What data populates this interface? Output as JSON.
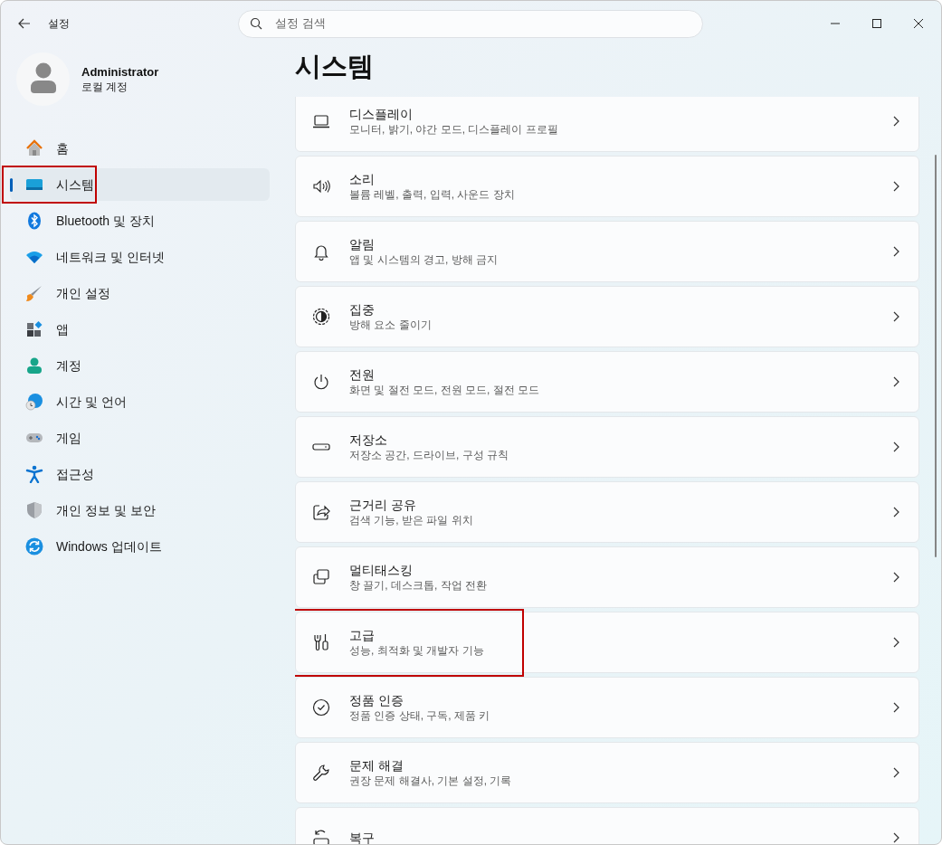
{
  "window": {
    "title": "설정",
    "search_placeholder": "설정 검색"
  },
  "account": {
    "name": "Administrator",
    "type": "로컬 계정"
  },
  "sidebar": {
    "items": [
      {
        "kind": "home",
        "label": "홈",
        "selected": false,
        "highlighted": false
      },
      {
        "kind": "system",
        "label": "시스템",
        "selected": true,
        "highlighted": true
      },
      {
        "kind": "bluetooth",
        "label": "Bluetooth 및 장치",
        "selected": false,
        "highlighted": false
      },
      {
        "kind": "network",
        "label": "네트워크 및 인터넷",
        "selected": false,
        "highlighted": false
      },
      {
        "kind": "brush",
        "label": "개인 설정",
        "selected": false,
        "highlighted": false
      },
      {
        "kind": "apps",
        "label": "앱",
        "selected": false,
        "highlighted": false
      },
      {
        "kind": "account",
        "label": "계정",
        "selected": false,
        "highlighted": false
      },
      {
        "kind": "time",
        "label": "시간 및 언어",
        "selected": false,
        "highlighted": false
      },
      {
        "kind": "game",
        "label": "게임",
        "selected": false,
        "highlighted": false
      },
      {
        "kind": "access",
        "label": "접근성",
        "selected": false,
        "highlighted": false
      },
      {
        "kind": "shield",
        "label": "개인 정보 및 보안",
        "selected": false,
        "highlighted": false
      },
      {
        "kind": "update",
        "label": "Windows 업데이트",
        "selected": false,
        "highlighted": false
      }
    ]
  },
  "page_title": "시스템",
  "cards": [
    {
      "kind": "display",
      "title": "디스플레이",
      "subtitle": "모니터, 밝기, 야간 모드, 디스플레이 프로필",
      "highlighted": false
    },
    {
      "kind": "sound",
      "title": "소리",
      "subtitle": "볼륨 레벨, 출력, 입력, 사운드 장치",
      "highlighted": false
    },
    {
      "kind": "bell",
      "title": "알림",
      "subtitle": "앱 및 시스템의 경고, 방해 금지",
      "highlighted": false
    },
    {
      "kind": "focus",
      "title": "집중",
      "subtitle": "방해 요소 줄이기",
      "highlighted": false
    },
    {
      "kind": "power",
      "title": "전원",
      "subtitle": "화면 및 절전 모드, 전원 모드, 절전 모드",
      "highlighted": false
    },
    {
      "kind": "storage",
      "title": "저장소",
      "subtitle": "저장소 공간, 드라이브, 구성 규칙",
      "highlighted": false
    },
    {
      "kind": "share",
      "title": "근거리 공유",
      "subtitle": "검색 기능, 받은 파일 위치",
      "highlighted": false
    },
    {
      "kind": "multitask",
      "title": "멀티태스킹",
      "subtitle": "창 끌기, 데스크톱, 작업 전환",
      "highlighted": false
    },
    {
      "kind": "tools",
      "title": "고급",
      "subtitle": "성능, 최적화 및 개발자 기능",
      "highlighted": true
    },
    {
      "kind": "check",
      "title": "정품 인증",
      "subtitle": "정품 인증 상태, 구독, 제품 키",
      "highlighted": false
    },
    {
      "kind": "wrench",
      "title": "문제 해결",
      "subtitle": "권장 문제 해결사, 기본 설정, 기록",
      "highlighted": false
    },
    {
      "kind": "recovery",
      "title": "복구",
      "highlighted": false
    }
  ]
}
